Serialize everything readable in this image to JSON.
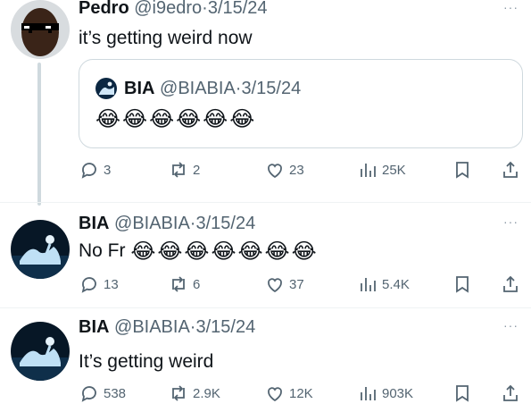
{
  "tweets": [
    {
      "name": "Pedro",
      "handle": "@i9edro",
      "sep": "·",
      "date": "3/15/24",
      "text": "it’s getting weird now",
      "more": "···",
      "quote": {
        "name": "BIA",
        "handle": "@BIABIA",
        "sep": "·",
        "date": "3/15/24",
        "emoji": "😂😂😂😂😂😂"
      },
      "actions": {
        "replies": "3",
        "retweets": "2",
        "likes": "23",
        "views": "25K"
      }
    },
    {
      "name": "BIA",
      "handle": "@BIABIA",
      "sep": "·",
      "date": "3/15/24",
      "text": "No Fr",
      "emoji": "😂😂😂😂😂😂😂",
      "more": "···",
      "actions": {
        "replies": "13",
        "retweets": "6",
        "likes": "37",
        "views": "5.4K"
      }
    },
    {
      "name": "BIA",
      "handle": "@BIABIA",
      "sep": "·",
      "date": "3/15/24",
      "text": "It’s getting weird",
      "more": "···",
      "actions": {
        "replies": "538",
        "retweets": "2.9K",
        "likes": "12K",
        "views": "903K"
      }
    }
  ]
}
